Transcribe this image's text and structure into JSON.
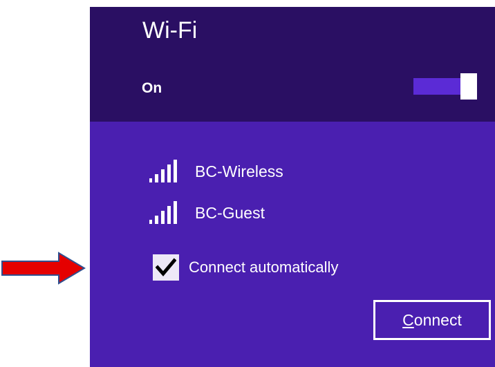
{
  "wifi": {
    "title": "Wi-Fi",
    "state_label": "On",
    "toggle_on": true
  },
  "networks": [
    {
      "ssid": "BC-Wireless",
      "icon": "wifi-signal-icon"
    },
    {
      "ssid": "BC-Guest",
      "icon": "wifi-signal-icon"
    }
  ],
  "auto_connect": {
    "label": "Connect automatically",
    "checked": true
  },
  "connect_button": {
    "label": "Connect"
  },
  "colors": {
    "header_bg": "#2a0f63",
    "body_bg": "#4a1fb0",
    "arrow_fill": "#e50000",
    "arrow_stroke": "#2f4f8f"
  }
}
